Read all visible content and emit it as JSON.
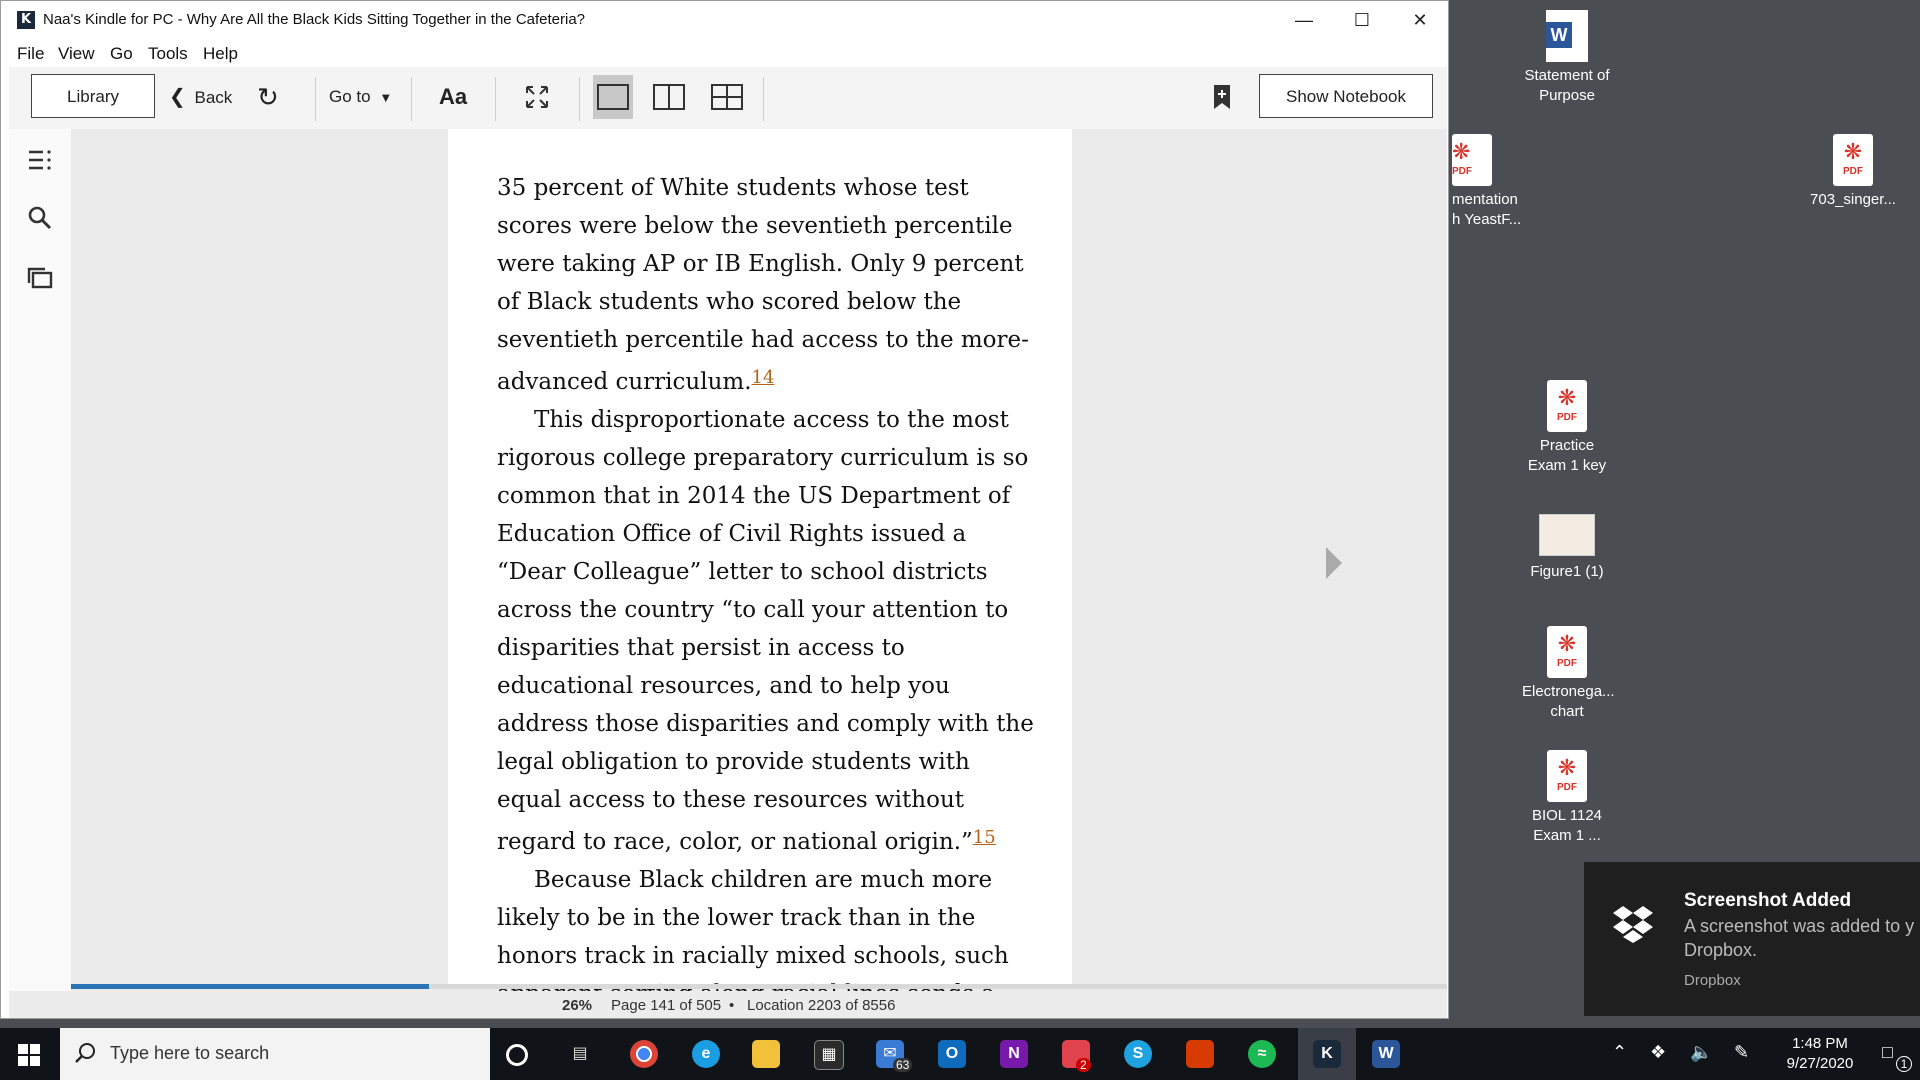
{
  "window": {
    "title": "Naa's Kindle for PC - Why Are All the Black Kids Sitting Together in the Cafeteria?",
    "app_icon": "K",
    "controls": {
      "minimize": "—",
      "maximize": "☐",
      "close": "✕"
    }
  },
  "menu": [
    "File",
    "View",
    "Go",
    "Tools",
    "Help"
  ],
  "toolbar": {
    "library": "Library",
    "back": "Back",
    "goto": "Go to",
    "font": "Aa",
    "show_notebook": "Show Notebook"
  },
  "book": {
    "paragraphs": [
      "35 percent of White students whose test scores were below the seventieth percentile were taking AP or IB English. Only 9 percent of Black students who scored below the seventieth percentile had access to the more-advanced curriculum.",
      "This disproportionate access to the most rigorous college preparatory curriculum is so common that in 2014 the US Department of Education Office of Civil Rights issued a “Dear Colleague” letter to school districts across the country “to call your attention to disparities that persist in access to educational resources, and to help you address those disparities and comply with the legal obligation to provide students with equal access to these resources without regard to race, color, or national origin.”",
      "Because Black children are much more likely to be in the lower track than in the honors track in racially mixed schools, such apparent sorting along racial lines sends a message about what it"
    ],
    "footnotes": [
      "14",
      "15"
    ]
  },
  "status": {
    "percent": "26%",
    "page": "Page 141 of 505",
    "dot": "•",
    "location": "Location 2203 of 8556",
    "progress_fraction": 0.26
  },
  "desktop": {
    "icons": [
      {
        "label1": "Statement of",
        "label2": "Purpose"
      },
      {
        "label1": "mentation",
        "label2": "h YeastF..."
      },
      {
        "label1": "703_singer...",
        "label2": ""
      },
      {
        "label1": "Practice",
        "label2": "Exam 1 key"
      },
      {
        "label1": "Figure1 (1)",
        "label2": ""
      },
      {
        "label1": "Electronega...",
        "label2": "chart"
      },
      {
        "label1": "BIOL 1124",
        "label2": "Exam 1 ..."
      }
    ],
    "pdf_tag": "PDF"
  },
  "notification": {
    "title": "Screenshot Added",
    "body1": "A screenshot was added to y",
    "body2": "Dropbox.",
    "source": "Dropbox"
  },
  "taskbar": {
    "search_placeholder": "Type here to search",
    "mail_badge": "63",
    "office_badge": "2",
    "time": "1:48 PM",
    "date": "9/27/2020",
    "notif_count": "1"
  },
  "colors": {
    "accent": "#2a73b6",
    "footnote": "#b4611a",
    "desktop": "#4a4d52"
  }
}
